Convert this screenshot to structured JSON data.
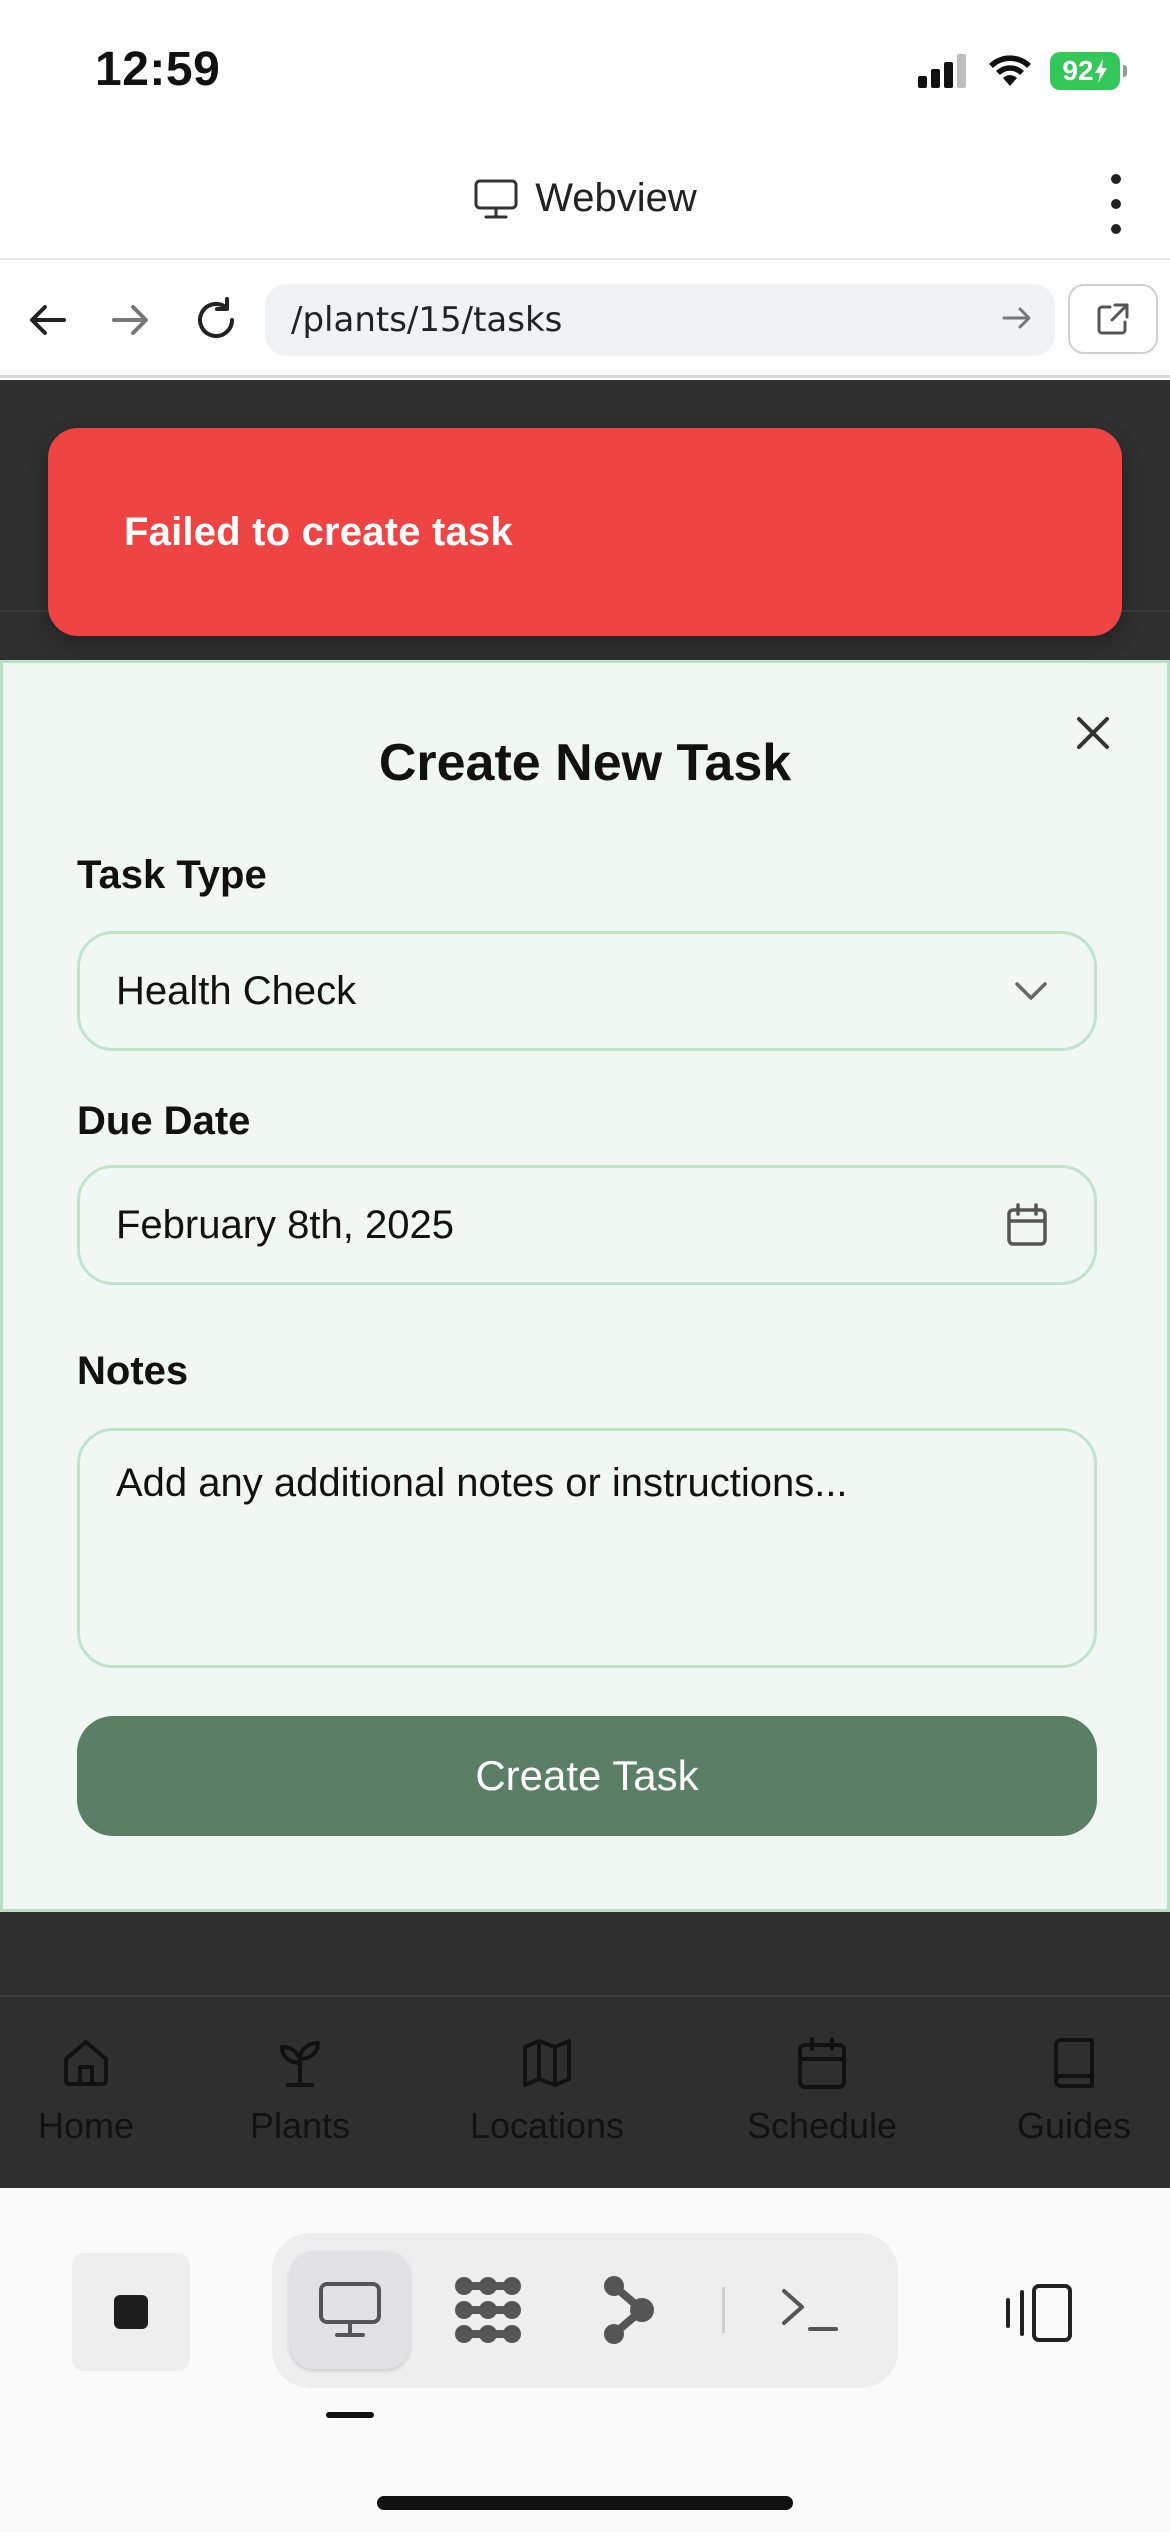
{
  "status_bar": {
    "time": "12:59",
    "battery": "92"
  },
  "webview": {
    "title": "Webview"
  },
  "browser": {
    "url": "/plants/15/tasks"
  },
  "toast": {
    "message": "Failed to create task"
  },
  "modal": {
    "title": "Create New Task",
    "task_type": {
      "label": "Task Type",
      "value": "Health Check"
    },
    "due_date": {
      "label": "Due Date",
      "value": "February 8th, 2025"
    },
    "notes": {
      "label": "Notes",
      "placeholder": "Add any additional notes or instructions..."
    },
    "submit_label": "Create Task"
  },
  "bottom_nav": {
    "items": [
      {
        "label": "Home",
        "icon": "home-icon"
      },
      {
        "label": "Plants",
        "icon": "sprout-icon"
      },
      {
        "label": "Locations",
        "icon": "map-icon"
      },
      {
        "label": "Schedule",
        "icon": "calendar-icon"
      },
      {
        "label": "Guides",
        "icon": "book-icon"
      }
    ]
  },
  "colors": {
    "toast": "#ef4444",
    "modal_bg": "#f1f8f3",
    "modal_border": "#b9e0c7",
    "submit": "#5a7f64",
    "app_bg": "#2f2f2f",
    "battery": "#34c759"
  }
}
